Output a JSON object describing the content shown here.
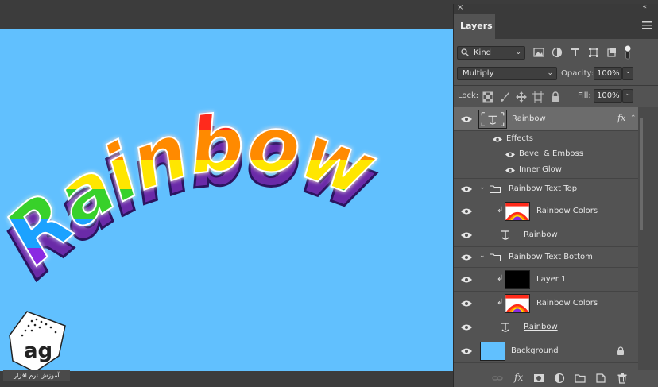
{
  "canvas": {
    "background_color": "#61c0fe",
    "artwork_text": "Rainbow",
    "watermark_caption": "آموزش نرم افزار"
  },
  "panel": {
    "close_glyph": "×",
    "collapse_glyph": "«",
    "tab_label": "Layers",
    "kind_filter": {
      "value": "Kind",
      "icon": "search-icon"
    },
    "filter_icons": [
      "image-filter-icon",
      "adjustment-filter-icon",
      "type-filter-icon",
      "shape-filter-icon",
      "smart-object-filter-icon",
      "filter-toggle-icon"
    ],
    "blend_mode": "Multiply",
    "opacity_label": "Opacity:",
    "opacity_value": "100%",
    "lock_label": "Lock:",
    "lock_icons": [
      "lock-transparent-icon",
      "lock-paint-icon",
      "lock-position-icon",
      "lock-artboard-icon",
      "lock-all-icon"
    ],
    "fill_label": "Fill:",
    "fill_value": "100%"
  },
  "layers": [
    {
      "name": "Rainbow",
      "kind": "type",
      "selected": true,
      "fx": "fx"
    },
    {
      "name": "Effects",
      "kind": "effects-header"
    },
    {
      "name": "Bevel & Emboss",
      "kind": "effect"
    },
    {
      "name": "Inner Glow",
      "kind": "effect"
    },
    {
      "name": "Rainbow Text Top",
      "kind": "group"
    },
    {
      "name": "Rainbow Colors",
      "kind": "clipped-image"
    },
    {
      "name": "Rainbow",
      "kind": "type-link"
    },
    {
      "name": "Rainbow Text Bottom",
      "kind": "group"
    },
    {
      "name": "Layer 1",
      "kind": "clipped-black"
    },
    {
      "name": "Rainbow Colors",
      "kind": "clipped-image"
    },
    {
      "name": "Rainbow",
      "kind": "type-link"
    },
    {
      "name": "Background",
      "kind": "background",
      "color": "#61c0fe"
    }
  ],
  "footer_icons": [
    "link-layers-icon",
    "add-style-icon",
    "add-mask-icon",
    "new-adjustment-icon",
    "new-group-icon",
    "new-layer-icon",
    "delete-layer-icon"
  ],
  "footer_fx_label": "fx",
  "colors": {
    "panel_bg": "#535353",
    "selected_row": "#6c6c6c",
    "rainbow": [
      "#ff2a1a",
      "#ff8a00",
      "#ffe600",
      "#39d12c",
      "#1fa2ff",
      "#8a2be2"
    ]
  }
}
